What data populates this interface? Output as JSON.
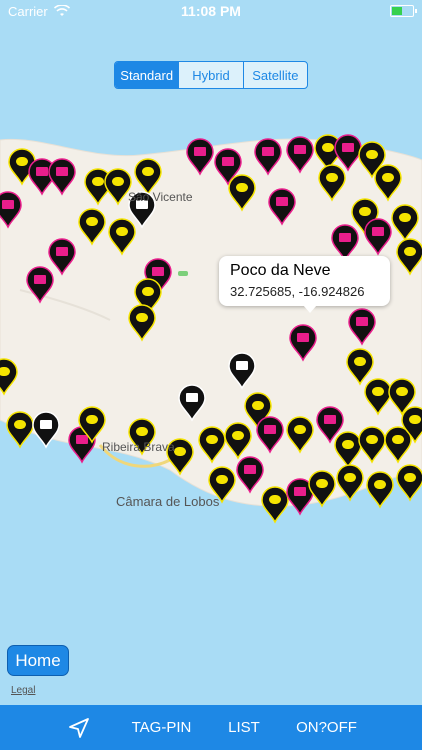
{
  "status_bar": {
    "carrier": "Carrier",
    "time": "11:08 PM"
  },
  "map_type_control": {
    "options": [
      "Standard",
      "Hybrid",
      "Satellite"
    ],
    "selected": "Standard"
  },
  "place_labels": [
    "São Vicente",
    "Ribeira Brava",
    "Câmara de Lobos"
  ],
  "callout": {
    "title": "Poco da Neve",
    "coordinates": "32.725685, -16.924826"
  },
  "home_button": {
    "label": "Home"
  },
  "legal_link": {
    "label": "Legal"
  },
  "toolbar": {
    "location_icon": "location-arrow-icon",
    "tag_pin": "TAG-PIN",
    "list": "LIST",
    "on_off": "ON?OFF"
  },
  "colors": {
    "accent": "#1e88e5",
    "water": "#a9dcf5",
    "land": "#f3efe8",
    "pin": "#111111",
    "pin_magenta": "#e91e8c",
    "pin_yellow": "#f5e400"
  }
}
